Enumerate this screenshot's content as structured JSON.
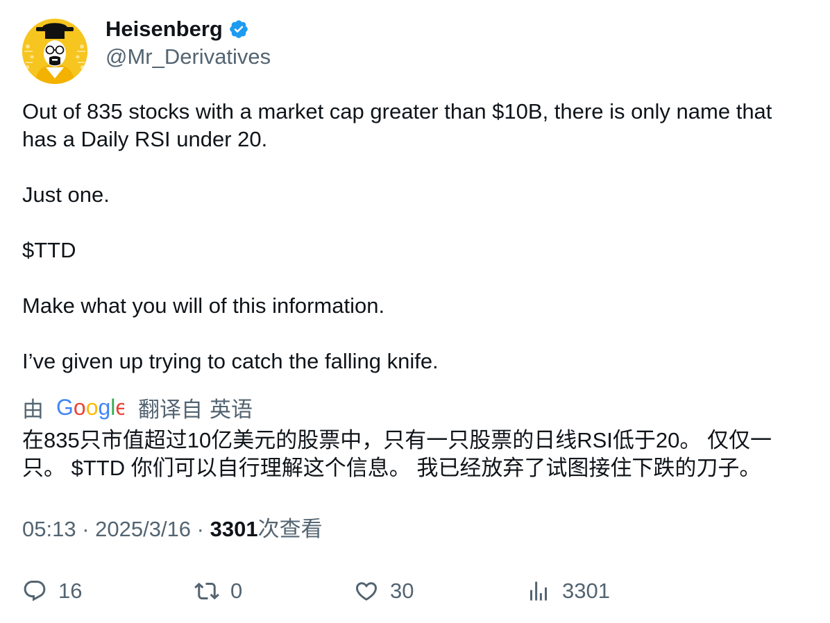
{
  "author": {
    "display_name": "Heisenberg",
    "handle": "@Mr_Derivatives",
    "verified": true,
    "avatar_icon": "heisenberg-avatar-icon"
  },
  "tweet": {
    "paragraphs": [
      "Out of 835 stocks with a market cap greater than $10B, there is only name that has a Daily RSI under 20.",
      "Just one.",
      "$TTD",
      "Make what you will of this information.",
      "I’ve given up trying to catch the falling knife."
    ]
  },
  "translation": {
    "by_label": "由",
    "provider": "Google",
    "from_label": "翻译自",
    "language": "英语",
    "text": "在835只市值超过10亿美元的股票中，只有一只股票的日线RSI低于20。 仅仅一只。 $TTD 你们可以自行理解这个信息。 我已经放弃了试图接住下跌的刀子。"
  },
  "meta": {
    "time": "05:13",
    "separator": " · ",
    "date": "2025/3/16",
    "views_count": "3301",
    "views_label": "次查看"
  },
  "actions": {
    "replies": "16",
    "reposts": "0",
    "likes": "30",
    "views": "3301"
  },
  "colors": {
    "text": "#0f1419",
    "secondary": "#536471",
    "verified": "#1d9bf0",
    "avatar_bg": "#f7c51f"
  }
}
